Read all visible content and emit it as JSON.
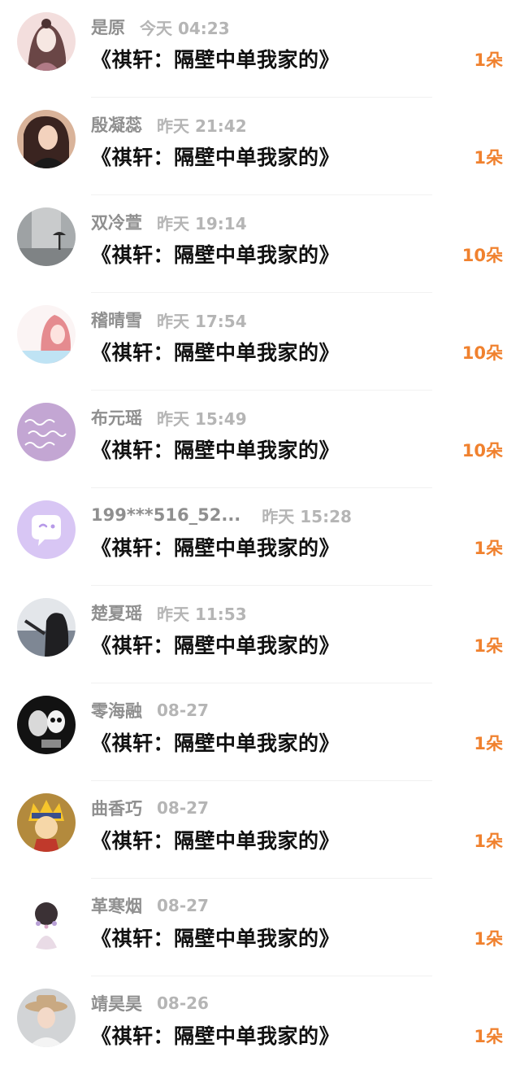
{
  "colors": {
    "name": "#8f8f8f",
    "time": "#b5b5b5",
    "title": "#111111",
    "amount": "#f0812e",
    "divider": "#f1f1f1"
  },
  "rows": [
    {
      "name": "是原",
      "time": "今天 04:23",
      "title": "《祺轩：隔壁中单我家的》",
      "amount": "1朵",
      "avatar": "girl-portrait-avatar"
    },
    {
      "name": "殷凝蕊",
      "time": "昨天 21:42",
      "title": "《祺轩：隔壁中单我家的》",
      "amount": "1朵",
      "avatar": "woman-photo-avatar"
    },
    {
      "name": "双冷萱",
      "time": "昨天 19:14",
      "title": "《祺轩：隔壁中单我家的》",
      "amount": "10朵",
      "avatar": "rainy-street-avatar"
    },
    {
      "name": "稽晴雪",
      "time": "昨天 17:54",
      "title": "《祺轩：隔壁中单我家的》",
      "amount": "10朵",
      "avatar": "anime-girl-avatar"
    },
    {
      "name": "布元瑶",
      "time": "昨天 15:49",
      "title": "《祺轩：隔壁中单我家的》",
      "amount": "10朵",
      "avatar": "handwriting-avatar"
    },
    {
      "name": "199***516_52...",
      "time": "昨天 15:28",
      "title": "《祺轩：隔壁中单我家的》",
      "amount": "1朵",
      "avatar": "default-chat-avatar"
    },
    {
      "name": "楚夏瑶",
      "time": "昨天 11:53",
      "title": "《祺轩：隔壁中单我家的》",
      "amount": "1朵",
      "avatar": "dark-photo-avatar"
    },
    {
      "name": "零海融",
      "time": "08-27",
      "title": "《祺轩：隔壁中单我家的》",
      "amount": "1朵",
      "avatar": "skull-art-avatar"
    },
    {
      "name": "曲香巧",
      "time": "08-27",
      "title": "《祺轩：隔壁中单我家的》",
      "amount": "1朵",
      "avatar": "cartoon-ninja-avatar"
    },
    {
      "name": "革寒烟",
      "time": "08-27",
      "title": "《祺轩：隔壁中单我家的》",
      "amount": "1朵",
      "avatar": "flower-hair-avatar"
    },
    {
      "name": "靖昊昊",
      "time": "08-26",
      "title": "《祺轩：隔壁中单我家的》",
      "amount": "1朵",
      "avatar": "hat-woman-avatar"
    }
  ]
}
